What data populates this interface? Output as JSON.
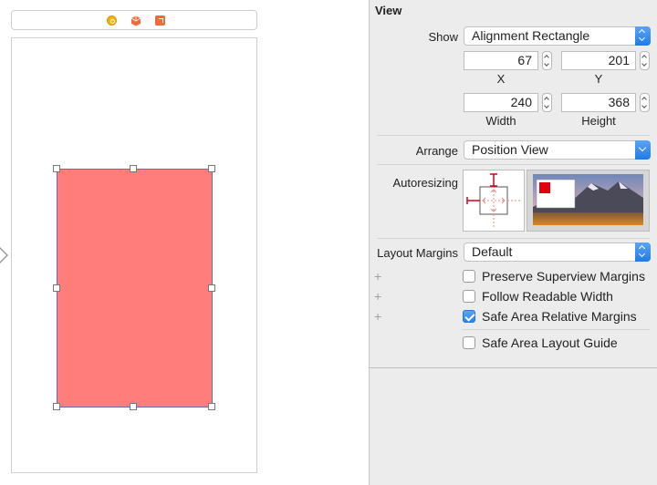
{
  "inspector": {
    "section_title": "View",
    "show": {
      "label": "Show",
      "value": "Alignment Rectangle"
    },
    "x": {
      "value": "67",
      "caption": "X"
    },
    "y": {
      "value": "201",
      "caption": "Y"
    },
    "width": {
      "value": "240",
      "caption": "Width"
    },
    "height": {
      "value": "368",
      "caption": "Height"
    },
    "arrange": {
      "label": "Arrange",
      "value": "Position View"
    },
    "autoresizing": {
      "label": "Autoresizing"
    },
    "layout_margins": {
      "label": "Layout Margins",
      "value": "Default"
    },
    "checkboxes": [
      {
        "label": "Preserve Superview Margins",
        "checked": false
      },
      {
        "label": "Follow Readable Width",
        "checked": false
      },
      {
        "label": "Safe Area Relative Margins",
        "checked": true
      },
      {
        "label": "Safe Area Layout Guide",
        "checked": false
      }
    ]
  },
  "canvas": {
    "selected_view_color": "#ff7e7b",
    "dock_icons": [
      "view-controller-icon",
      "first-responder-icon",
      "exit-icon"
    ]
  },
  "colors": {
    "accent": "#2a84ec",
    "autoresize_strut": "#d0021b"
  }
}
